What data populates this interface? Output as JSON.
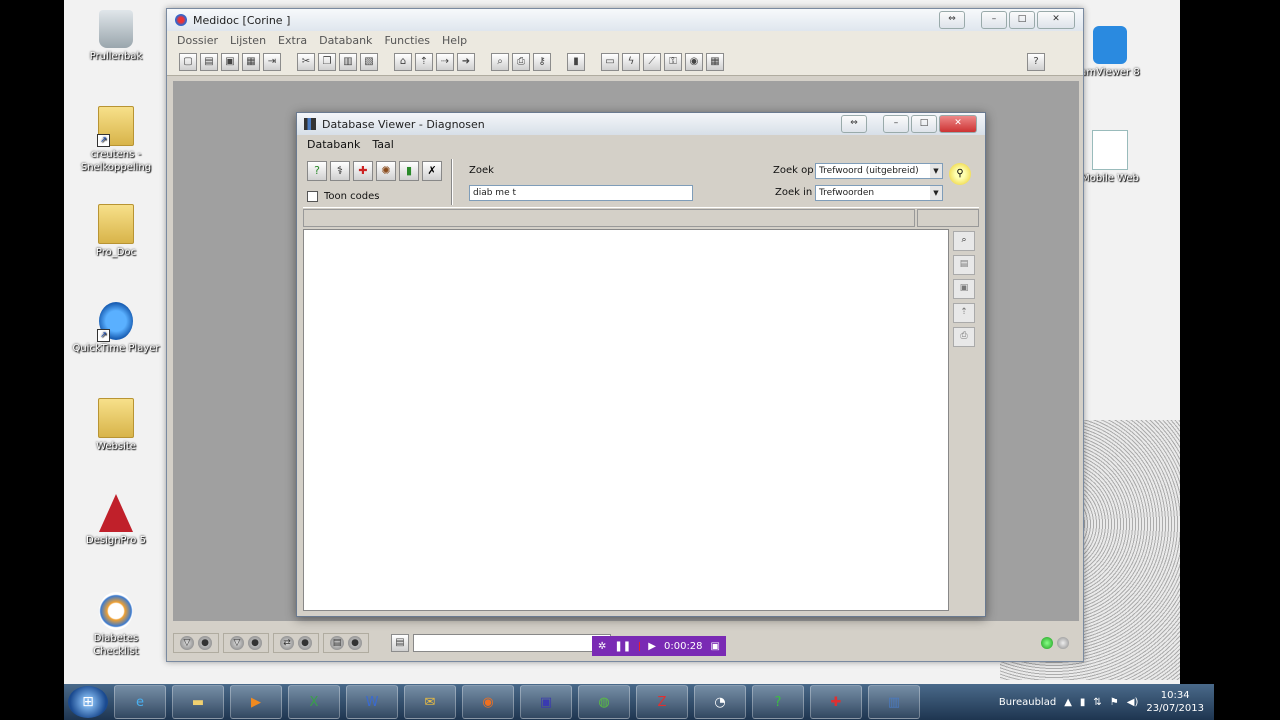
{
  "desktop": {
    "icons": [
      {
        "label": "Prullenbak",
        "icon": "recycle-bin-icon"
      },
      {
        "label": "creutens - Snelkoppeling",
        "icon": "folder-icon"
      },
      {
        "label": "Pro_Doc",
        "icon": "folder-icon"
      },
      {
        "label": "QuickTime Player",
        "icon": "quicktime-icon"
      },
      {
        "label": "Website",
        "icon": "folder-icon"
      },
      {
        "label": "DesignPro 5",
        "icon": "designpro-icon"
      },
      {
        "label": "Diabetes Checklist",
        "icon": "diabetes-checklist-icon"
      },
      {
        "label": "amViewer 8",
        "icon": "teamviewer-icon"
      },
      {
        "label": "Mobile Web",
        "icon": "document-icon"
      }
    ]
  },
  "main_window": {
    "title": "Medidoc [Corine ]",
    "menu": [
      "Dossier",
      "Lijsten",
      "Extra",
      "Databank",
      "Functies",
      "Help"
    ],
    "help_button": "?"
  },
  "dialog": {
    "title": "Database Viewer - Diagnosen",
    "menu": [
      "Databank",
      "Taal"
    ],
    "toon_codes_label": "Toon codes",
    "zoek_label": "Zoek",
    "zoek_value": "diab me t",
    "zoek_op_label": "Zoek op",
    "zoek_op_value": "Trefwoord (uitgebreid)",
    "zoek_in_label": "Zoek in",
    "zoek_in_value": "Trefwoorden"
  },
  "recorder": {
    "time": "0:00:28"
  },
  "taskbar": {
    "desktop_label": "Bureaublad",
    "time": "10:34",
    "date": "23/07/2013"
  },
  "colors": {
    "accent": "#7a2ab4",
    "title_bar": "#dfe6ee",
    "workspace": "#a0a0a0"
  }
}
